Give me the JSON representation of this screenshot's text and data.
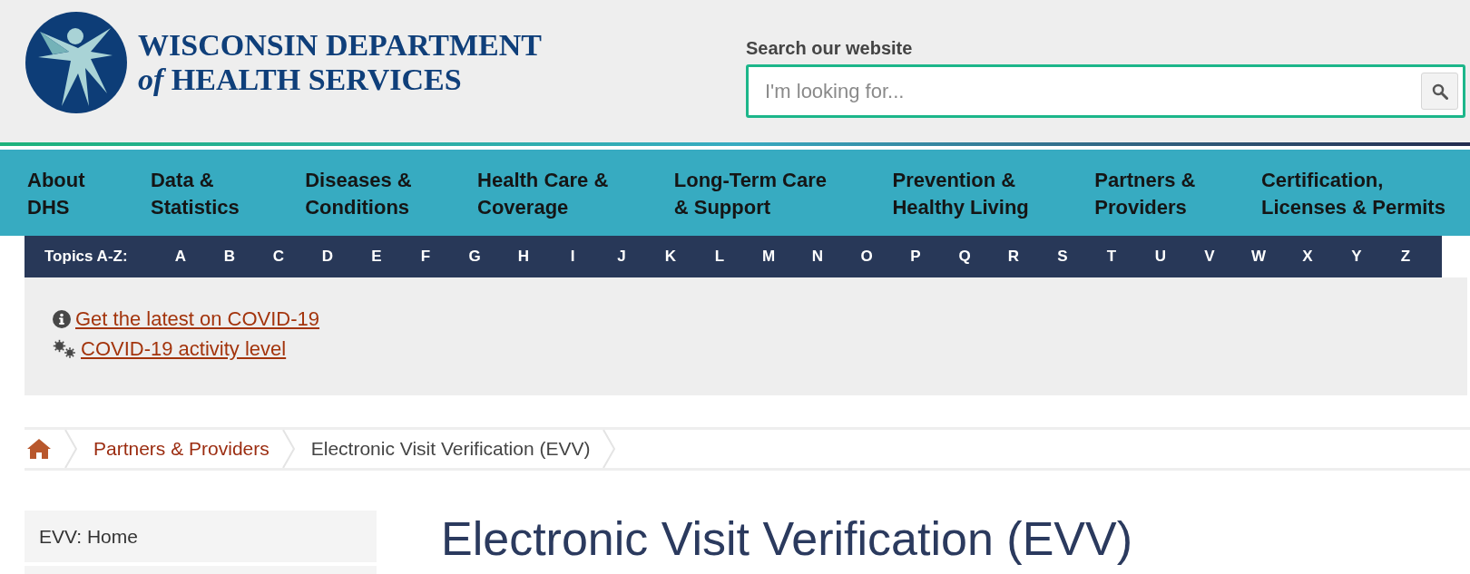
{
  "header": {
    "logo": {
      "lines": [
        "WISCONSIN DEPARTMENT",
        "*of* HEALTH SERVICES"
      ]
    },
    "search": {
      "label": "Search our website",
      "placeholder": "I'm looking for..."
    }
  },
  "main_nav": [
    {
      "lines": [
        "About",
        "DHS"
      ]
    },
    {
      "lines": [
        "Data &",
        "Statistics"
      ]
    },
    {
      "lines": [
        "Diseases &",
        "Conditions"
      ]
    },
    {
      "lines": [
        "Health Care &",
        "Coverage"
      ]
    },
    {
      "lines": [
        "Long-Term Care",
        "& Support"
      ]
    },
    {
      "lines": [
        "Prevention &",
        "Healthy Living"
      ]
    },
    {
      "lines": [
        "Partners &",
        "Providers"
      ]
    },
    {
      "lines": [
        "Certification,",
        "Licenses & Permits"
      ]
    }
  ],
  "topics_bar": {
    "label": "Topics A-Z:",
    "letters": [
      "A",
      "B",
      "C",
      "D",
      "E",
      "F",
      "G",
      "H",
      "I",
      "J",
      "K",
      "L",
      "M",
      "N",
      "O",
      "P",
      "Q",
      "R",
      "S",
      "T",
      "U",
      "V",
      "W",
      "X",
      "Y",
      "Z"
    ]
  },
  "alerts": [
    {
      "kind": "info",
      "text": "Get the latest on COVID-19"
    },
    {
      "kind": "activity",
      "text": "COVID-19 activity level"
    }
  ],
  "breadcrumb": [
    {
      "kind": "home"
    },
    {
      "kind": "link",
      "label": "Partners & Providers"
    },
    {
      "kind": "current",
      "label": "Electronic Visit Verification (EVV)"
    }
  ],
  "sidebar": {
    "items": [
      "EVV: Home"
    ]
  },
  "page_title": "Electronic Visit Verification (EVV)"
}
